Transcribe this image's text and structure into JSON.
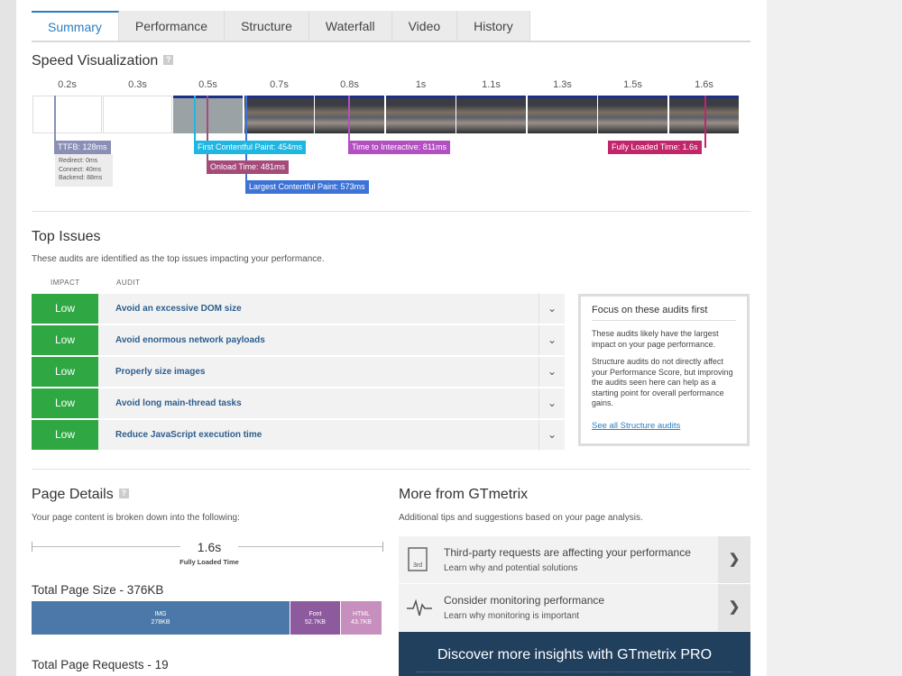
{
  "tabs": [
    "Summary",
    "Performance",
    "Structure",
    "Waterfall",
    "Video",
    "History"
  ],
  "speed": {
    "title": "Speed Visualization",
    "help": "?",
    "times": [
      "0.2s",
      "0.3s",
      "0.5s",
      "0.7s",
      "0.8s",
      "1s",
      "1.1s",
      "1.3s",
      "1.5s",
      "1.6s"
    ],
    "markers": {
      "ttfb": "TTFB: 128ms",
      "redirect": "Redirect: 0ms",
      "connect": "Connect: 40ms",
      "backend": "Backend: 88ms",
      "fcp": "First Contentful Paint: 454ms",
      "onload": "Onload Time: 481ms",
      "lcp": "Largest Contentful Paint: 573ms",
      "tti": "Time to Interactive: 811ms",
      "fully": "Fully Loaded Time: 1.6s"
    },
    "colors": {
      "ttfb": "#8a8fb5",
      "fcp": "#1fb6e1",
      "onload": "#a44b7a",
      "lcp": "#3d73d6",
      "tti": "#b24fc2",
      "fully": "#c1266a"
    }
  },
  "issues": {
    "title": "Top Issues",
    "subtitle": "These audits are identified as the top issues impacting your performance.",
    "col_impact": "IMPACT",
    "col_audit": "AUDIT",
    "rows": [
      {
        "impact": "Low",
        "audit": "Avoid an excessive DOM size"
      },
      {
        "impact": "Low",
        "audit": "Avoid enormous network payloads"
      },
      {
        "impact": "Low",
        "audit": "Properly size images"
      },
      {
        "impact": "Low",
        "audit": "Avoid long main-thread tasks"
      },
      {
        "impact": "Low",
        "audit": "Reduce JavaScript execution time"
      }
    ],
    "impact_color": "#2fa844"
  },
  "focus": {
    "title": "Focus on these audits first",
    "p1": "These audits likely have the largest impact on your page performance.",
    "p2": "Structure audits do not directly affect your Performance Score, but improving the audits seen here can help as a starting point for overall performance gains.",
    "link": "See all Structure audits"
  },
  "details": {
    "title": "Page Details",
    "help": "?",
    "subtitle": "Your page content is broken down into the following:",
    "fully_value": "1.6s",
    "fully_caption": "Fully Loaded Time",
    "size_title": "Total Page Size - 376KB",
    "requests_title": "Total Page Requests - 19",
    "size_bars": [
      {
        "label": "IMG",
        "value": "278KB",
        "color": "#4b78a8"
      },
      {
        "label": "Font",
        "value": "52.7KB",
        "color": "#8e5a9e"
      },
      {
        "label": "HTML",
        "value": "43.7KB",
        "color": "#c78fbe"
      }
    ]
  },
  "more": {
    "title": "More from GTmetrix",
    "subtitle": "Additional tips and suggestions based on your page analysis.",
    "items": [
      {
        "title": "Third-party requests are affecting your performance",
        "sub": "Learn why and potential solutions",
        "icon": "3rd"
      },
      {
        "title": "Consider monitoring performance",
        "sub": "Learn why monitoring is important",
        "icon": "pulse-icon"
      }
    ],
    "pro": "Discover more insights with GTmetrix PRO"
  }
}
